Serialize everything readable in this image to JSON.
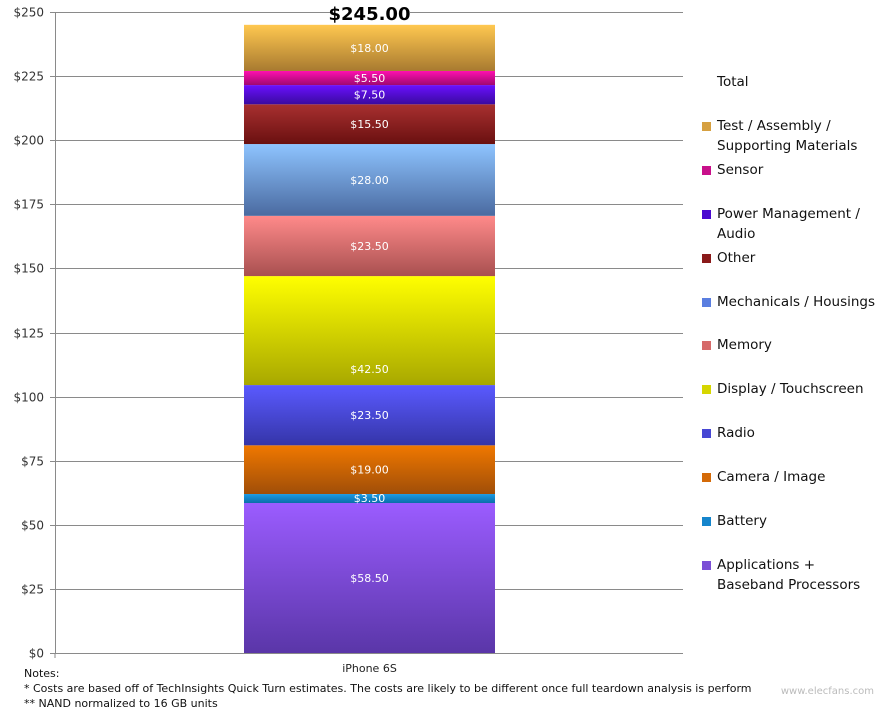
{
  "chart_data": {
    "type": "bar",
    "stacked": true,
    "title": "",
    "xlabel": "",
    "ylabel": "",
    "ylim": [
      0,
      250
    ],
    "yticks": [
      0,
      25,
      50,
      75,
      100,
      125,
      150,
      175,
      200,
      225,
      250
    ],
    "ytick_labels": [
      "$0",
      "$25",
      "$50",
      "$75",
      "$100",
      "$125",
      "$150",
      "$175",
      "$200",
      "$225",
      "$250"
    ],
    "grid": true,
    "legend_position": "right",
    "categories": [
      "iPhone 6S"
    ],
    "total_label": "$245.00",
    "total": 245.0,
    "series": [
      {
        "name": "Applications + Baseband Processors",
        "values": [
          58.5
        ],
        "label": "$58.50",
        "color_top": "#9b5cff",
        "color_bottom": "#5a36a8",
        "swatch": "#7b4fd6"
      },
      {
        "name": "Battery",
        "values": [
          3.5
        ],
        "label": "$3.50",
        "color_top": "#1a9be6",
        "color_bottom": "#0b6ea8",
        "swatch": "#1585cc"
      },
      {
        "name": "Camera / Image",
        "values": [
          19.0
        ],
        "label": "$19.00",
        "color_top": "#f07800",
        "color_bottom": "#a04e08",
        "swatch": "#d46a08"
      },
      {
        "name": "Radio",
        "values": [
          23.5
        ],
        "label": "$23.50",
        "color_top": "#5a5aff",
        "color_bottom": "#3535a8",
        "swatch": "#4747d4"
      },
      {
        "name": "Display / Touchscreen",
        "values": [
          42.5
        ],
        "label": "$42.50",
        "color_top": "#ffff00",
        "color_bottom": "#a8a800",
        "swatch": "#d6d600"
      },
      {
        "name": "Memory",
        "values": [
          23.5
        ],
        "label": "$23.50",
        "color_top": "#ff8a8a",
        "color_bottom": "#a85050",
        "swatch": "#d66a6a"
      },
      {
        "name": "Mechanicals / Housings",
        "values": [
          28.0
        ],
        "label": "$28.00",
        "color_top": "#8ec4ff",
        "color_bottom": "#4a6aa0",
        "swatch": "#5a7ee0"
      },
      {
        "name": "Other",
        "values": [
          15.5
        ],
        "label": "$15.50",
        "color_top": "#a83030",
        "color_bottom": "#6a1010",
        "swatch": "#8a1a1a"
      },
      {
        "name": "Power Management / Audio",
        "values": [
          7.5
        ],
        "label": "$7.50",
        "color_top": "#6a10ff",
        "color_bottom": "#3a0aa0",
        "swatch": "#4a0ad0"
      },
      {
        "name": "Sensor",
        "values": [
          5.5
        ],
        "label": "$5.50",
        "color_top": "#ff10b0",
        "color_bottom": "#a00870",
        "swatch": "#c8108a"
      },
      {
        "name": "Test / Assembly / Supporting Materials",
        "values": [
          18.0
        ],
        "label": "$18.00",
        "color_top": "#ffc850",
        "color_bottom": "#a87a30",
        "swatch": "#d6a040"
      }
    ],
    "legend_order": [
      {
        "name": "Total",
        "swatch": null
      },
      {
        "name": "Test / Assembly / Supporting Materials",
        "swatch": "#d6a040"
      },
      {
        "name": "Sensor",
        "swatch": "#c8108a"
      },
      {
        "name": "Power Management / Audio",
        "swatch": "#4a0ad0"
      },
      {
        "name": "Other",
        "swatch": "#8a1a1a"
      },
      {
        "name": "Mechanicals / Housings",
        "swatch": "#5a7ee0"
      },
      {
        "name": "Memory",
        "swatch": "#d66a6a"
      },
      {
        "name": "Display / Touchscreen",
        "swatch": "#d6d600"
      },
      {
        "name": "Radio",
        "swatch": "#4747d4"
      },
      {
        "name": "Camera / Image",
        "swatch": "#d46a08"
      },
      {
        "name": "Battery",
        "swatch": "#1585cc"
      },
      {
        "name": "Applications + Baseband Processors",
        "swatch": "#7b4fd6"
      }
    ]
  },
  "notes": {
    "heading": "Notes:",
    "line1": "* Costs are based off of TechInsights Quick Turn estimates.  The costs are likely to be different once full teardown analysis is perform",
    "line2": "** NAND normalized to 16 GB units"
  },
  "watermark": "www.elecfans.com"
}
